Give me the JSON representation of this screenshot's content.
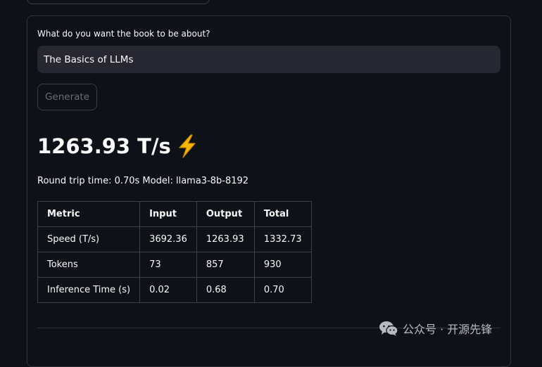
{
  "form": {
    "prompt_label": "What do you want the book to be about?",
    "prompt_value": "The Basics of LLMs",
    "generate_label": "Generate"
  },
  "result": {
    "speed_heading": "1263.93 T/s",
    "speed_icon": "lightning-bolt-icon",
    "stats_line": "Round trip time: 0.70s Model: llama3-8b-8192"
  },
  "table": {
    "headers": [
      "Metric",
      "Input",
      "Output",
      "Total"
    ],
    "rows": [
      [
        "Speed (T/s)",
        "3692.36",
        "1263.93",
        "1332.73"
      ],
      [
        "Tokens",
        "73",
        "857",
        "930"
      ],
      [
        "Inference Time (s)",
        "0.02",
        "0.68",
        "0.70"
      ]
    ]
  },
  "watermark": {
    "icon": "wechat-icon",
    "text": "公众号 · 开源先锋"
  },
  "colors": {
    "background": "#0e1117",
    "input_background": "#262730",
    "border": "#31343d",
    "bolt": "#f5b700"
  }
}
